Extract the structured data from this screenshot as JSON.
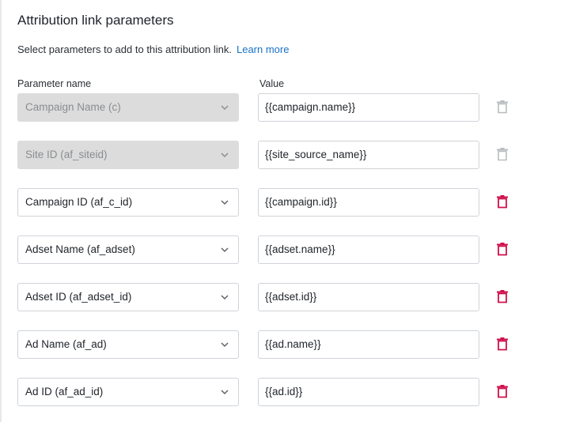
{
  "section": {
    "title": "Attribution link parameters",
    "description": "Select parameters to add to this attribution link.",
    "learn_more": "Learn more"
  },
  "columns": {
    "name": "Parameter name",
    "value": "Value"
  },
  "colors": {
    "delete_active": "#d0104c",
    "delete_disabled": "#b9bcc0",
    "link": "#1a73c8",
    "disabled_field": "#dcdcdc"
  },
  "rows": [
    {
      "parameter": "Campaign Name (c)",
      "value": "{{campaign.name}}",
      "disabled": true
    },
    {
      "parameter": "Site ID (af_siteid)",
      "value": "{{site_source_name}}",
      "disabled": true
    },
    {
      "parameter": "Campaign ID (af_c_id)",
      "value": "{{campaign.id}}",
      "disabled": false
    },
    {
      "parameter": "Adset Name (af_adset)",
      "value": "{{adset.name}}",
      "disabled": false
    },
    {
      "parameter": "Adset ID (af_adset_id)",
      "value": "{{adset.id}}",
      "disabled": false
    },
    {
      "parameter": "Ad Name (af_ad)",
      "value": "{{ad.name}}",
      "disabled": false
    },
    {
      "parameter": "Ad ID (af_ad_id)",
      "value": "{{ad.id}}",
      "disabled": false
    }
  ]
}
